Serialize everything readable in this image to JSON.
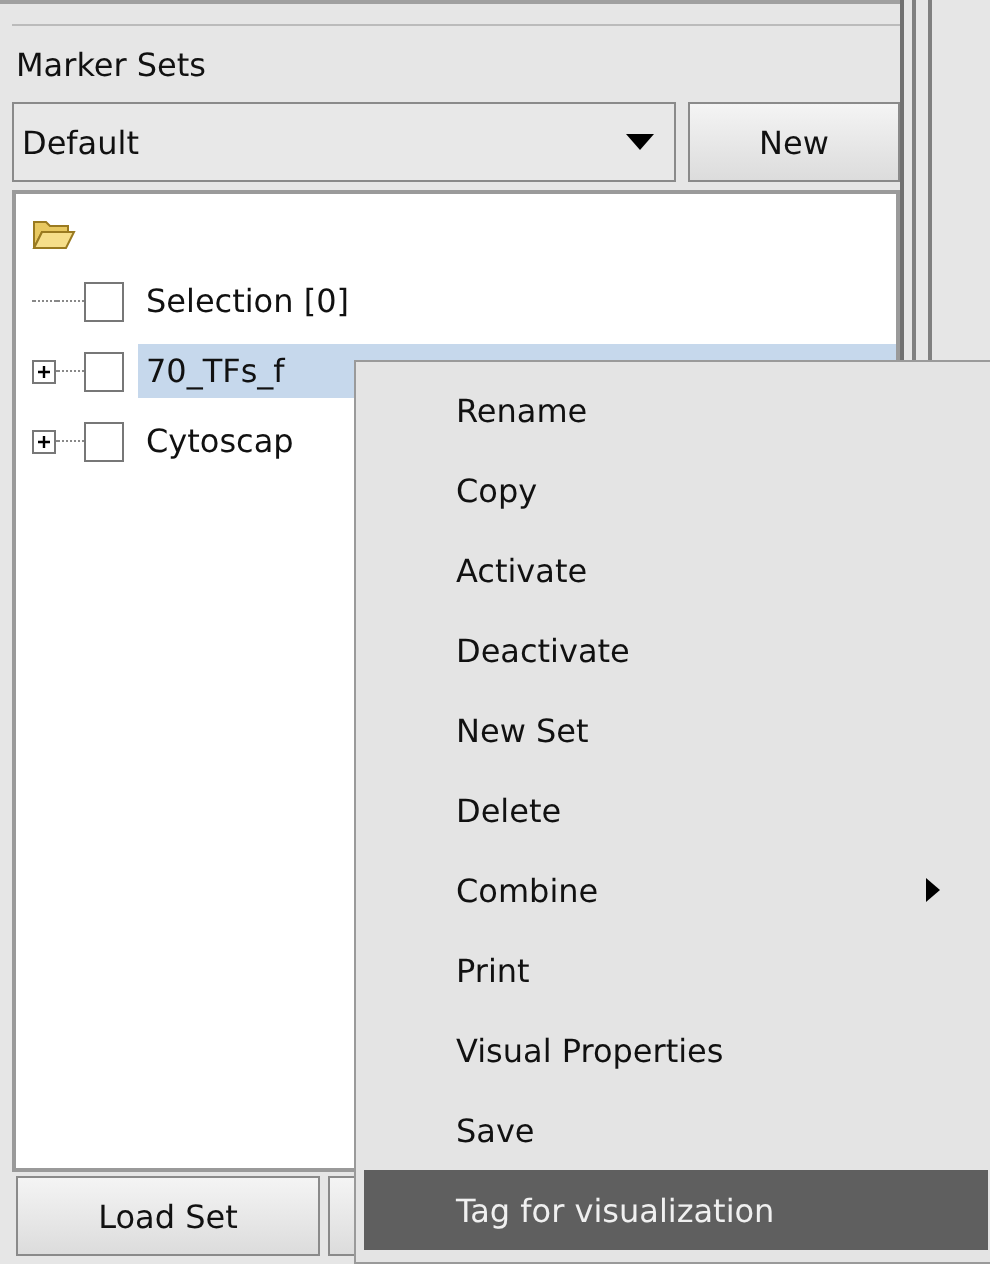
{
  "panel": {
    "title": "Marker Sets"
  },
  "set_selector": {
    "value": "Default"
  },
  "new_button": "New",
  "tree": {
    "items": [
      {
        "label": "Selection [0]",
        "expandable": false,
        "checked": false,
        "selected": false
      },
      {
        "label": "70_TFs_f",
        "expandable": true,
        "checked": false,
        "selected": true
      },
      {
        "label": "Cytoscap",
        "expandable": true,
        "checked": false,
        "selected": false
      }
    ]
  },
  "bottom_buttons": [
    "Load Set"
  ],
  "context_menu": {
    "items": [
      {
        "label": "Rename",
        "submenu": false,
        "selected": false
      },
      {
        "label": "Copy",
        "submenu": false,
        "selected": false
      },
      {
        "label": "Activate",
        "submenu": false,
        "selected": false
      },
      {
        "label": "Deactivate",
        "submenu": false,
        "selected": false
      },
      {
        "label": "New Set",
        "submenu": false,
        "selected": false
      },
      {
        "label": "Delete",
        "submenu": false,
        "selected": false
      },
      {
        "label": "Combine",
        "submenu": true,
        "selected": false
      },
      {
        "label": "Print",
        "submenu": false,
        "selected": false
      },
      {
        "label": "Visual Properties",
        "submenu": false,
        "selected": false
      },
      {
        "label": "Save",
        "submenu": false,
        "selected": false
      },
      {
        "label": "Tag for visualization",
        "submenu": false,
        "selected": true
      }
    ]
  }
}
